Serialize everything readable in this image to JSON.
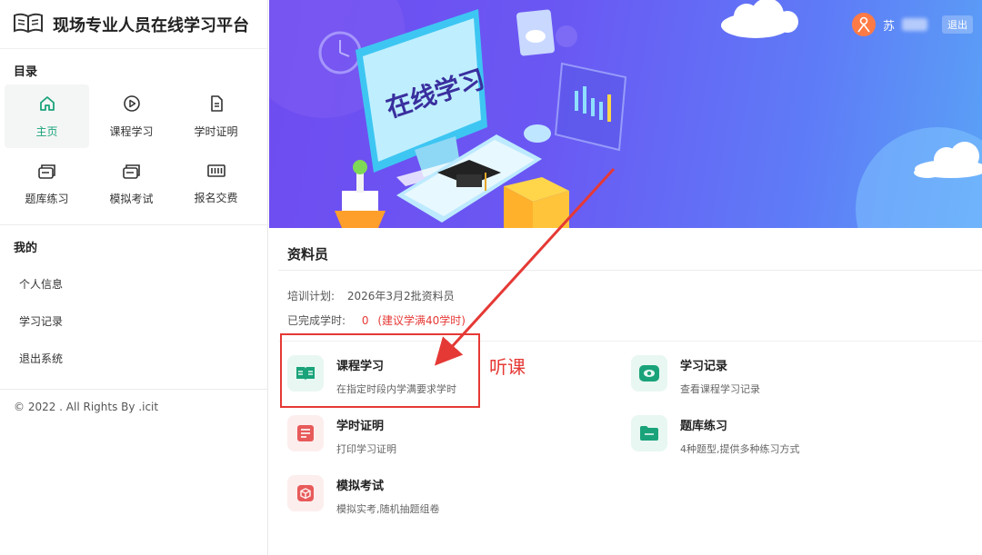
{
  "app": {
    "title": "现场专业人员在线学习平台"
  },
  "sidebar": {
    "catalog_label": "目录",
    "nav": [
      {
        "label": "主页",
        "icon": "home-icon"
      },
      {
        "label": "课程学习",
        "icon": "play-circle-icon"
      },
      {
        "label": "学时证明",
        "icon": "document-icon"
      },
      {
        "label": "题库练习",
        "icon": "question-bank-icon"
      },
      {
        "label": "模拟考试",
        "icon": "exam-icon"
      },
      {
        "label": "报名交费",
        "icon": "payment-icon"
      }
    ],
    "mine_label": "我的",
    "mine": [
      {
        "label": "个人信息"
      },
      {
        "label": "学习记录"
      },
      {
        "label": "退出系统"
      }
    ],
    "copyright": "© 2022 . All Rights By .icit"
  },
  "banner": {
    "screen_text": "在线学习",
    "user": {
      "name": "苏",
      "logout": "退出"
    }
  },
  "main": {
    "title": "资料员",
    "plan_label": "培训计划:",
    "plan_value": "2026年3月2批资料员",
    "hours_label": "已完成学时:",
    "hours_value": "0",
    "hours_note": "(建议学满40学时)",
    "cards": [
      {
        "title": "课程学习",
        "desc": "在指定时段内学满要求学时",
        "icon": "open-book-icon",
        "color": "#1aa37a"
      },
      {
        "title": "学习记录",
        "desc": "查看课程学习记录",
        "icon": "eye-icon",
        "color": "#1aa37a"
      },
      {
        "title": "学时证明",
        "desc": "打印学习证明",
        "icon": "certificate-icon",
        "color": "#e85a5a"
      },
      {
        "title": "题库练习",
        "desc": "4种题型,提供多种练习方式",
        "icon": "folder-icon",
        "color": "#1aa37a"
      },
      {
        "title": "模拟考试",
        "desc": "模拟实考,随机抽题组卷",
        "icon": "cube-icon",
        "color": "#e85a5a"
      }
    ]
  },
  "annotation": {
    "text": "听课"
  },
  "colors": {
    "accent": "#1aa37a",
    "annotation": "#e53935",
    "banner": "#6a58f3"
  }
}
